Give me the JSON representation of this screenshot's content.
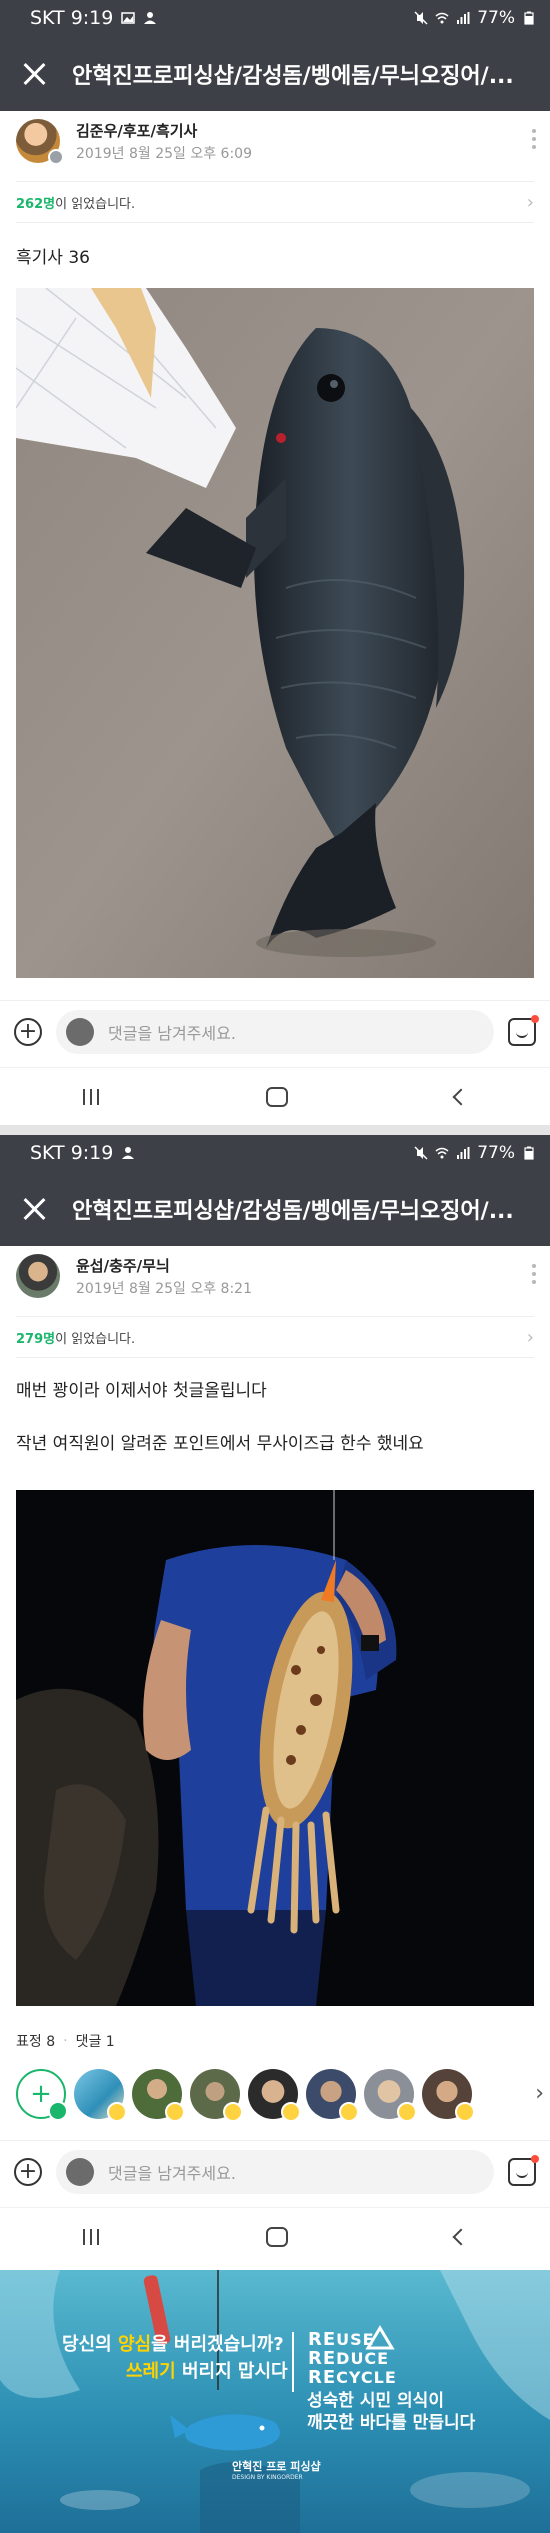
{
  "status_bar": {
    "carrier_time": "SKT 9:19",
    "battery": "77%"
  },
  "app_bar": {
    "title": "안혁진프로피싱샵/감성돔/벵에돔/무늬오징어/..."
  },
  "posts": [
    {
      "author_name": "김준우/후포/흑기사",
      "date": "2019년 8월 25일 오후 6:09",
      "read_count": "262명",
      "read_suffix": "이 읽었습니다.",
      "text_lines": [
        "흑기사  36"
      ],
      "photo_subject": "black fish held by angler"
    },
    {
      "author_name": "윤섭/충주/무늬",
      "date": "2019년 8월 25일 오후 8:21",
      "read_count": "279명",
      "read_suffix": "이 읽었습니다.",
      "text_lines": [
        "매번 꽝이라 이제서야 첫글올립니다",
        "작년  여직원이 알려준 포인트에서 무사이즈급 한수 했네요"
      ],
      "photo_subject": "cuttlefish held at night",
      "reactions_label": "표정 8",
      "comments_label": "댓글 1"
    }
  ],
  "comment_bar": {
    "placeholder": "댓글을 남겨주세요."
  },
  "banner": {
    "line1_pre": "당신의 ",
    "line1_hl": "양심",
    "line1_post": "을 버리겠습니까?",
    "line2_hl": "쓰레기",
    "line2_post": " 버리지 맙시다",
    "reuse_big": "RE",
    "reuse_small": "USE",
    "reduce_big": "RE",
    "reduce_small": "DUCE",
    "recycle_big": "RE",
    "recycle_small": "CYCLE",
    "slogan1": "성숙한 시민 의식이",
    "slogan2": "깨끗한 바다를 만듭니다",
    "logo_text": "안혁진 프로 피싱샵",
    "design_credit": "DESIGN BY KINGORDER"
  },
  "colors": {
    "app_bar": "#3d4046",
    "accent_green": "#19b66b",
    "banner_blue": "#2c8fb3"
  },
  "icons": [
    "close-icon",
    "more-icon",
    "add-icon",
    "sticker-icon",
    "recent-apps-icon",
    "home-icon",
    "back-icon",
    "chevron-right-icon"
  ]
}
